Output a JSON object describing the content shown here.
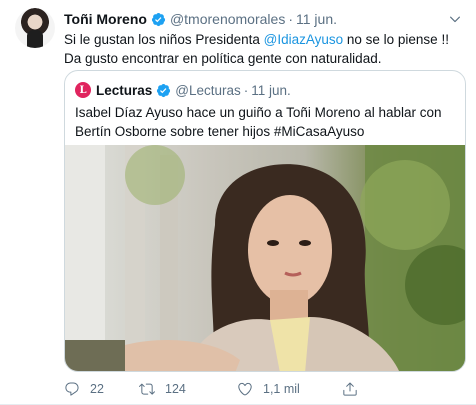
{
  "tweet": {
    "author_name": "Toñi Moreno",
    "author_handle": "@tmorenomorales",
    "separator": "·",
    "date": "11 jun.",
    "text_before": "Si le gustan los niños Presidenta ",
    "mention": "@IdiazAyuso",
    "text_after": " no se lo piense !! Da gusto encontrar en política gente con naturalidad."
  },
  "quoted": {
    "logo_letter": "L",
    "author_name": "Lecturas",
    "author_handle": "@Lecturas",
    "separator": "·",
    "date": "11 jun.",
    "text": "Isabel Díaz Ayuso hace un guiño a Toñi Moreno al hablar con Bertín Osborne sobre tener hijos #MiCasaAyuso lecturas.com/actualidad/mi-..."
  },
  "actions": {
    "replies": "22",
    "retweets": "124",
    "likes": "1,1 mil"
  },
  "colors": {
    "accent": "#1b95e0",
    "secondary_text": "#5b7083",
    "verified": "#1da1f2",
    "lecturas_brand": "#e0245e"
  }
}
